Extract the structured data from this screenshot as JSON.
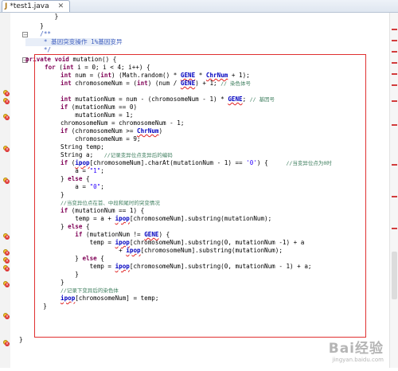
{
  "tab": {
    "icon": "java-file-icon",
    "title": "*test1.java",
    "close": "✕"
  },
  "watermark": {
    "main": "Bai经验",
    "url": "jingyan.baidu.com"
  },
  "code": {
    "l1": "        }",
    "l2": "    }",
    "l3": "    /**",
    "l4": "     * 基因突变操作 1%基因变异",
    "l5": "     */",
    "sig_kw": "private void",
    "sig_rest": " mutation() {",
    "for_kw": "for",
    "for_int": "int",
    "for_rest": " i = 0; i < 4; i++) {",
    "num_kw": "int",
    "num_a": " num = (",
    "num_int2": "int",
    "num_b": ") (Math.random() * ",
    "gene1": "GENE",
    "num_c": " * ",
    "chrnum1": "ChrNum",
    "num_d": " + 1);",
    "cn_kw": "int",
    "cn_a": " chromosomeNum = (",
    "cn_int2": "int",
    "cn_b": ") (num / ",
    "gene2": "GENE",
    "cn_c": ") + 1; ",
    "cn_cm": "// 染色体号",
    "mn_kw": "int",
    "mn_a": " mutationNum = num - (chromosomeNum - 1) * ",
    "gene3": "GENE",
    "mn_b": "; ",
    "mn_cm": "// 基因号",
    "if1_kw": "if",
    "if1_rest": " (mutationNum == 0)",
    "if1_body": "    mutationNum = 1;",
    "cm_line": "chromosomeNum = chromosomeNum - 1;",
    "if2_kw": "if",
    "if2_a": " (chromosomeNum >= ",
    "chrnum2": "ChrNum",
    "if2_b": ")",
    "if2_body": "    chromosomeNum = 9;",
    "temp_decl": "String temp;",
    "a_decl": "String a;   ",
    "a_cm": "//记录变异位点变异后的编码",
    "if3_kw": "if",
    "if3_a": " (",
    "ipop1": "ipop",
    "if3_b": "[chromosomeNum].charAt(mutationNum - 1) == ",
    "if3_str": "'0'",
    "if3_c": ") {     ",
    "if3_cm": "//当变异位点为0时",
    "a1_a": "    a = ",
    "a1_str": "\"1\"",
    "a1_b": ";",
    "else1_a": "} ",
    "else1_kw": "else",
    "else1_b": " {",
    "a2_a": "    a = ",
    "a2_str": "\"0\"",
    "a2_b": ";",
    "close1": "}",
    "cm2": "//当变异位点在首、中段和尾时的突变情况",
    "if4_kw": "if",
    "if4_rest": " (mutationNum == 1) {",
    "t1_a": "    temp = a + ",
    "ipop2": "ipop",
    "t1_b": "[chromosomeNum].substring(mutationNum);",
    "else2_a": "} ",
    "else2_kw": "else",
    "else2_b": " {",
    "if5_a": "    ",
    "if5_kw": "if",
    "if5_b": " (mutationNum != ",
    "gene4": "GENE",
    "if5_c": ") {",
    "t2_a": "        temp = ",
    "ipop3": "ipop",
    "t2_b": "[chromosomeNum].substring(0, mutationNum -1) + a",
    "t3_a": "                + ",
    "ipop4": "ipop",
    "t3_b": "[chromosomeNum].substring(mutationNum);",
    "else3_a": "    } ",
    "else3_kw": "else",
    "else3_b": " {",
    "t4_a": "        temp = ",
    "ipop5": "ipop",
    "t4_b": "[chromosomeNum].substring(0, mutationNum - 1) + a;",
    "close2": "    }",
    "close3": "}",
    "cm3": "//记录下变异后的染色体",
    "ipop6": "ipop",
    "last_b": "[chromosomeNum] = temp;",
    "close4": "    }",
    "close5": "}"
  }
}
